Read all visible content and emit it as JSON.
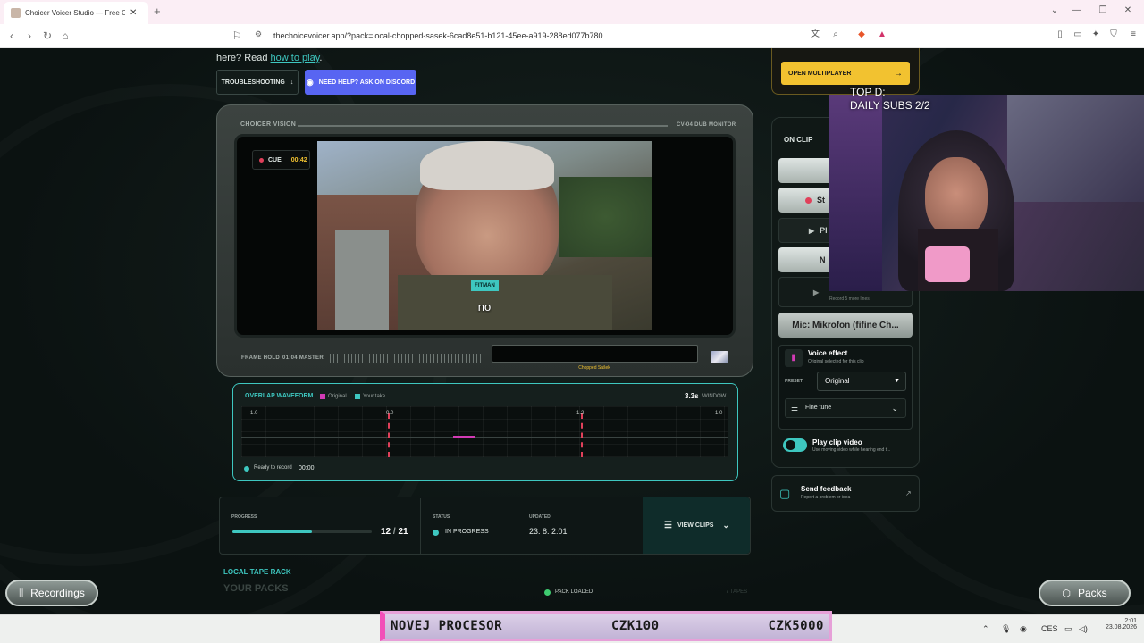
{
  "browser": {
    "tab_title": "Choicer Voicer Studio — Free Online",
    "url": "thechoicevoicer.app/?pack=local-chopped-sasek-6cad8e51-b121-45ee-a919-288ed077b780"
  },
  "intro": {
    "prefix": "here? Read ",
    "link": "how to play",
    "suffix": "."
  },
  "buttons": {
    "troubleshooting": "TROUBLESHOOTING",
    "discord": "NEED HELP? ASK ON DISCORD",
    "open_multiplayer": "OPEN MULTIPLAYER"
  },
  "monitor": {
    "brand": "CHOICER VISION",
    "model": "CV-04 DUB MONITOR",
    "cue_label": "CUE",
    "cue_time": "00:42",
    "speaker_tag": "FITMAN",
    "subtitle": "no",
    "frame_label": "FRAME HOLD",
    "master_label": "01:04 MASTER",
    "pack_name": "Chopped Sašek"
  },
  "waveform": {
    "title": "OVERLAP WAVEFORM",
    "legend_original": "Original",
    "legend_take": "Your take",
    "window_value": "3.3s",
    "window_label": "WINDOW",
    "ticks": [
      "-1.0",
      "0.0",
      "1.2",
      "-1.0"
    ],
    "status": "Ready to record",
    "status_time": "00:00",
    "colors": {
      "original": "#d23bb5",
      "take": "#3ec7c0",
      "marker": "#e0405a"
    }
  },
  "progress": {
    "label": "PROGRESS",
    "current": "12",
    "separator": "/",
    "total": "21",
    "fraction": 0.5714,
    "status_label": "STATUS",
    "status_value": "IN PROGRESS",
    "updated_label": "UPDATED",
    "updated_value": "23. 8. 2:01",
    "view_clips": "VIEW CLIPS"
  },
  "tape": {
    "section_label": "LOCAL TAPE RACK",
    "heading": "YOUR PACKS",
    "pack_status": "PACK LOADED",
    "tapes": "7 TAPES"
  },
  "right_panel": {
    "header": "ON CLIP",
    "btn_stop_partial": "St",
    "btn_play_partial": "Pl",
    "btn_next_partial": "N",
    "record_sub": "Record 5 more lines",
    "mic": "Mic: Mikrofon (fifine Ch...",
    "voice_effect_title": "Voice effect",
    "voice_effect_sub": "Original selected for this clip",
    "preset_label": "PRESET",
    "preset_value": "Original",
    "fine_tune": "Fine tune",
    "play_clip_title": "Play clip video",
    "play_clip_sub": "Use moving video while hearing end t...",
    "feedback_title": "Send feedback",
    "feedback_sub": "Report a problem or idea"
  },
  "webcam": {
    "overlay_line1": "TOP D:",
    "overlay_line2": "DAILY SUBS 2/2"
  },
  "bottom": {
    "recordings": "Recordings",
    "packs": "Packs"
  },
  "ticker": {
    "item1": "NOVEJ PROCESOR",
    "item2": "CZK100",
    "item3": "CZK5000"
  },
  "taskbar": {
    "lang": "CES",
    "time": "2:01",
    "date": "23.08.2026"
  }
}
